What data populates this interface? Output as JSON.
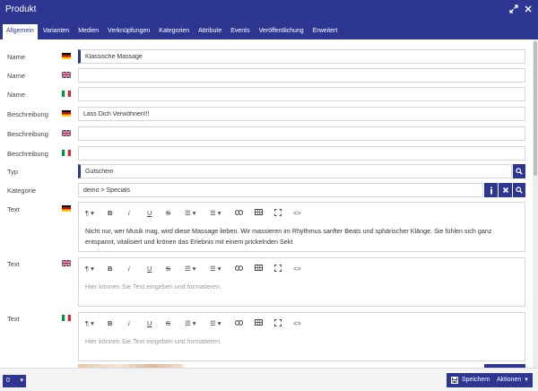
{
  "window": {
    "title": "Produkt"
  },
  "tabs": [
    {
      "label": "Allgemein",
      "active": true
    },
    {
      "label": "Varianten"
    },
    {
      "label": "Medien"
    },
    {
      "label": "Verknüpfungen"
    },
    {
      "label": "Kategorien"
    },
    {
      "label": "Attribute"
    },
    {
      "label": "Events"
    },
    {
      "label": "Veröffentlichung"
    },
    {
      "label": "Erweitert"
    }
  ],
  "fields": {
    "name_de": {
      "label": "Name",
      "value": "Klassische Massage"
    },
    "name_en": {
      "label": "Name",
      "value": ""
    },
    "name_it": {
      "label": "Name",
      "value": ""
    },
    "desc_de": {
      "label": "Beschreibung",
      "value": "Lass Dich Verwöhnen!!!"
    },
    "desc_en": {
      "label": "Beschreibung",
      "value": ""
    },
    "desc_it": {
      "label": "Beschreibung",
      "value": ""
    },
    "typ": {
      "label": "Typ",
      "value": "Gutschein"
    },
    "kategorie": {
      "label": "Kategorie",
      "value": "demo > Specials"
    }
  },
  "editors": {
    "text_de": {
      "label": "Text",
      "content": "Nicht nur, wer Musik mag, wird diese Massage lieben. Wir massieren im Rhythmus sanfter Beats und sphärischer Klänge. Sie fühlen sich ganz entspannt, vitalisiert und krönen das Erlebnis mit einem prickelnden Sekt"
    },
    "text_en": {
      "label": "Text",
      "placeholder": "Hier können Sie Text eingeben und formatieren"
    },
    "text_it": {
      "label": "Text",
      "placeholder": "Hier können Sie Text eingeben und formatieren"
    }
  },
  "toolbar": {
    "bold": "B",
    "italic": "i",
    "underline": "U",
    "strike": "S",
    "code": "<>"
  },
  "footer": {
    "counter": "0",
    "save_label": "Speichern",
    "actions_label": "Aktionen"
  },
  "colors": {
    "primary": "#2d3792"
  }
}
